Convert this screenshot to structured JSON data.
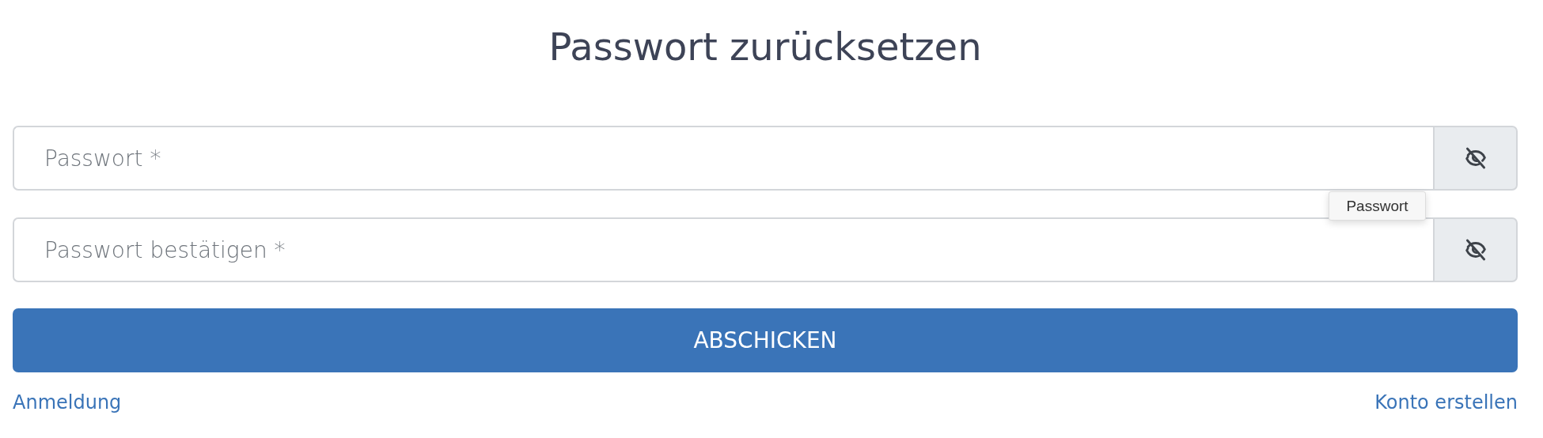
{
  "title": "Passwort zurücksetzen",
  "fields": [
    {
      "placeholder": "Passwort *",
      "visible": false
    },
    {
      "placeholder": "Passwort bestätigen *",
      "visible": false
    }
  ],
  "tooltip": {
    "text": "Passwort"
  },
  "submit": "ABSCHICKEN",
  "links": [
    {
      "label": "Anmeldung"
    },
    {
      "label": "Konto erstellen"
    }
  ]
}
